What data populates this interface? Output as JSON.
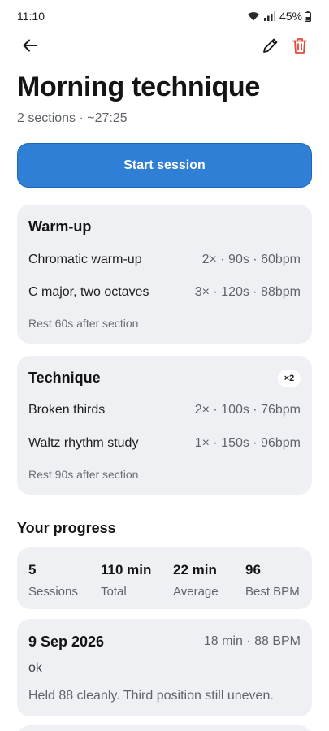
{
  "status_bar": {
    "time": "11:10",
    "battery": "45%",
    "icons": [
      "wifi-icon",
      "signal-icon",
      "battery-icon"
    ]
  },
  "toolbar": {
    "icons": [
      "back-arrow-icon",
      "pencil-icon",
      "trash-icon"
    ],
    "delete_color": "#e04a3a"
  },
  "routine": {
    "title": "Morning technique",
    "summary": "2 sections · ~27:25"
  },
  "start_button": {
    "label": "Start session",
    "color": "#2f7fd6"
  },
  "sections": [
    {
      "name": "Warm-up",
      "exercises": [
        {
          "name": "Chromatic warm-up",
          "meta": "2× · 90s · 60bpm"
        },
        {
          "name": "C major, two octaves",
          "meta": "3× · 120s · 88bpm"
        }
      ],
      "rest": "Rest 60s after section"
    },
    {
      "name": "Technique",
      "repeat": "×2",
      "exercises": [
        {
          "name": "Broken thirds",
          "meta": "2× · 100s · 76bpm"
        },
        {
          "name": "Waltz rhythm study",
          "meta": "1× · 150s · 96bpm"
        }
      ],
      "rest": "Rest 90s after section"
    }
  ],
  "progress": {
    "heading": "Your progress",
    "stats": [
      {
        "value": "5",
        "label": "Sessions"
      },
      {
        "value": "110 min",
        "label": "Total"
      },
      {
        "value": "22 min",
        "label": "Average"
      },
      {
        "value": "96",
        "label": "Best BPM"
      }
    ],
    "entries": [
      {
        "date": "9 Sep 2026",
        "meta": "18 min · 88 BPM",
        "note": "ok",
        "comment": "Held 88 cleanly. Third position still uneven."
      }
    ]
  }
}
